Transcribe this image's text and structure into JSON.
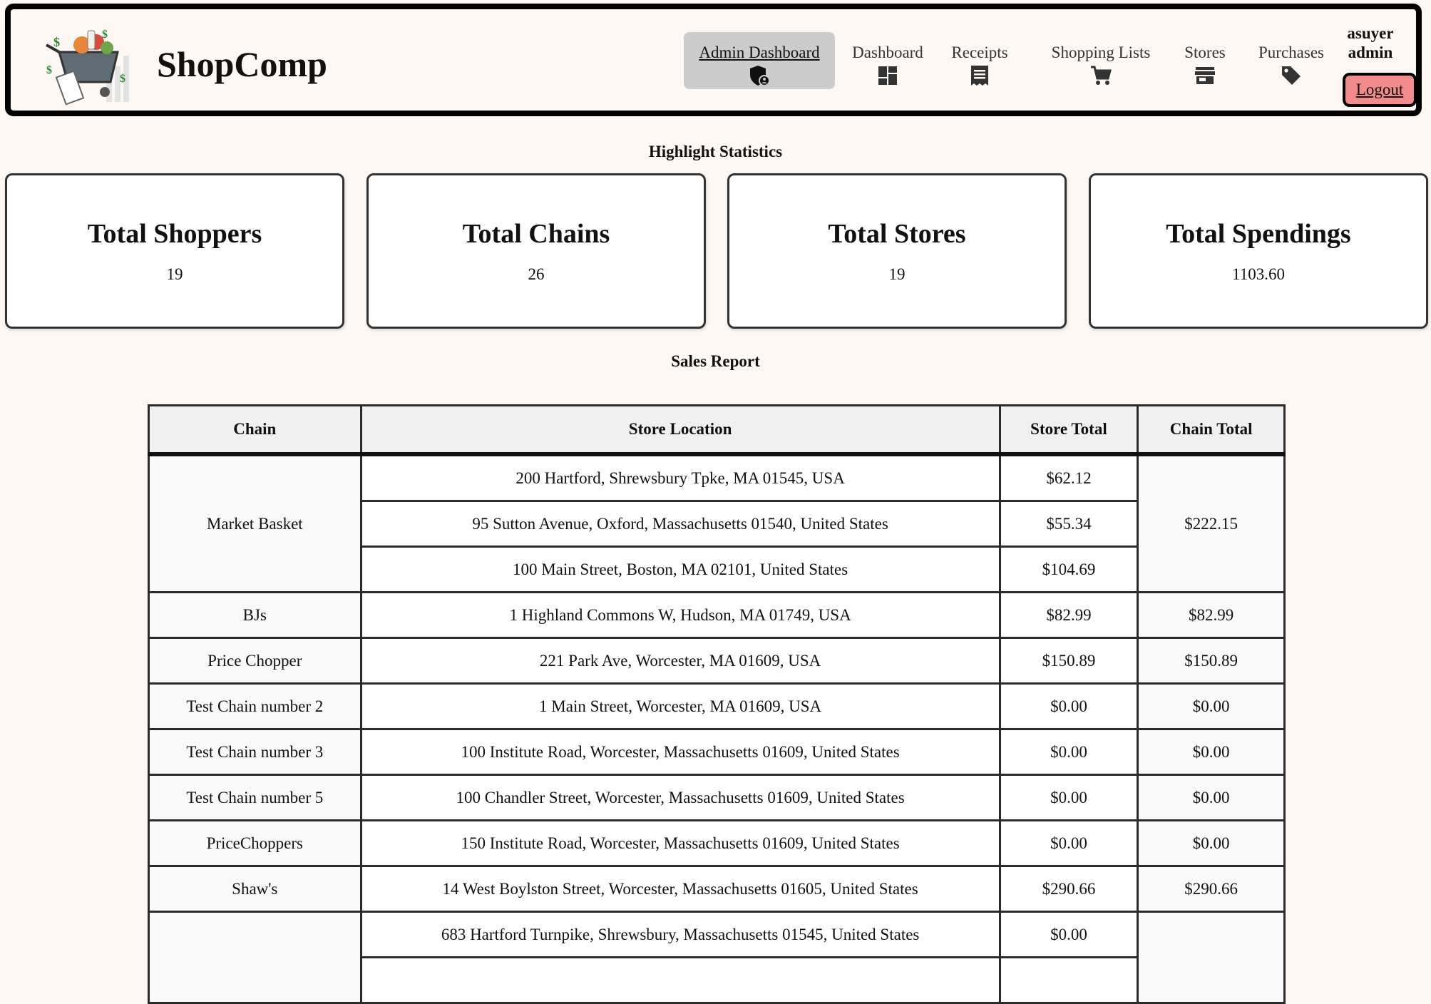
{
  "header": {
    "brand": "ShopComp",
    "nav": [
      {
        "label": "Admin Dashboard",
        "icon": "shield-user-icon",
        "active": true
      },
      {
        "label": "Dashboard",
        "icon": "dashboard-icon"
      },
      {
        "label": "Receipts",
        "icon": "receipt-icon"
      },
      {
        "label": "Shopping Lists",
        "icon": "cart-icon"
      },
      {
        "label": "Stores",
        "icon": "store-icon"
      },
      {
        "label": "Purchases",
        "icon": "tag-icon"
      }
    ],
    "user": {
      "name": "asuyer",
      "role": "admin"
    },
    "logout_label": "Logout"
  },
  "highlights": {
    "title": "Highlight Statistics",
    "cards": [
      {
        "title": "Total Shoppers",
        "value": "19"
      },
      {
        "title": "Total Chains",
        "value": "26"
      },
      {
        "title": "Total Stores",
        "value": "19"
      },
      {
        "title": "Total Spendings",
        "value": "1103.60"
      }
    ]
  },
  "sales_report": {
    "title": "Sales Report",
    "columns": [
      "Chain",
      "Store Location",
      "Store Total",
      "Chain Total"
    ],
    "groups": [
      {
        "chain": "Market Basket",
        "chain_total": "$222.15",
        "stores": [
          {
            "location": "200 Hartford, Shrewsbury Tpke, MA 01545, USA",
            "total": "$62.12"
          },
          {
            "location": "95 Sutton Avenue, Oxford, Massachusetts 01540, United States",
            "total": "$55.34"
          },
          {
            "location": "100 Main Street, Boston, MA 02101, United States",
            "total": "$104.69"
          }
        ]
      },
      {
        "chain": "BJs",
        "chain_total": "$82.99",
        "stores": [
          {
            "location": "1 Highland Commons W, Hudson, MA 01749, USA",
            "total": "$82.99"
          }
        ]
      },
      {
        "chain": "Price Chopper",
        "chain_total": "$150.89",
        "stores": [
          {
            "location": "221 Park Ave, Worcester, MA 01609, USA",
            "total": "$150.89"
          }
        ]
      },
      {
        "chain": "Test Chain number 2",
        "chain_total": "$0.00",
        "stores": [
          {
            "location": "1 Main Street, Worcester, MA 01609, USA",
            "total": "$0.00"
          }
        ]
      },
      {
        "chain": "Test Chain number 3",
        "chain_total": "$0.00",
        "stores": [
          {
            "location": "100 Institute Road, Worcester, Massachusetts 01609, United States",
            "total": "$0.00"
          }
        ]
      },
      {
        "chain": "Test Chain number 5",
        "chain_total": "$0.00",
        "stores": [
          {
            "location": "100 Chandler Street, Worcester, Massachusetts 01609, United States",
            "total": "$0.00"
          }
        ]
      },
      {
        "chain": "PriceChoppers",
        "chain_total": "$0.00",
        "stores": [
          {
            "location": "150 Institute Road, Worcester, Massachusetts 01609, United States",
            "total": "$0.00"
          }
        ]
      },
      {
        "chain": "Shaw's",
        "chain_total": "$290.66",
        "stores": [
          {
            "location": "14 West Boylston Street, Worcester, Massachusetts 01605, United States",
            "total": "$290.66"
          }
        ]
      },
      {
        "chain": "",
        "chain_total": "",
        "stores": [
          {
            "location": "683 Hartford Turnpike, Shrewsbury, Massachusetts 01545, United States",
            "total": "$0.00"
          },
          {
            "location": "",
            "total": ""
          }
        ]
      }
    ]
  }
}
